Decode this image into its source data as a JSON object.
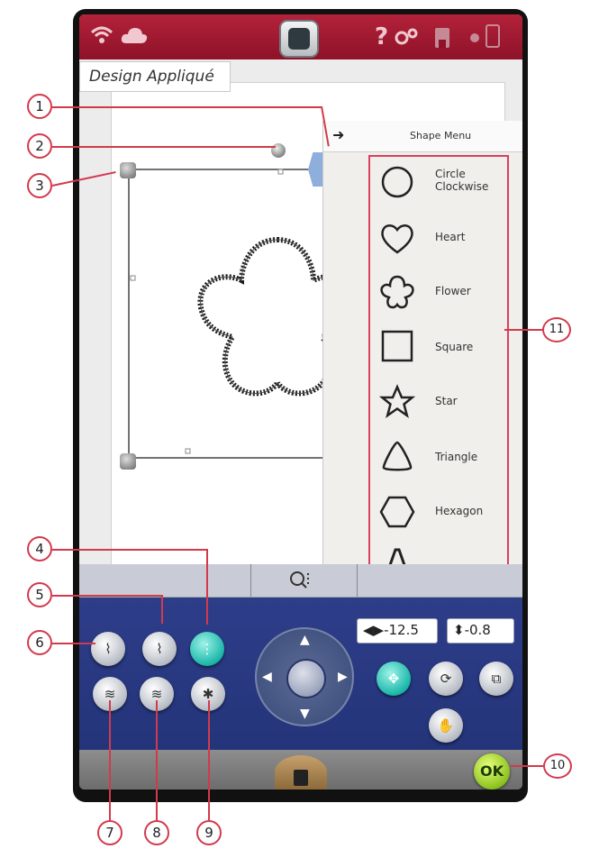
{
  "title": "Design Appliqué",
  "shape_menu": {
    "header": "Shape Menu",
    "items": [
      {
        "label": "Circle\nClockwise",
        "icon": "circle-icon"
      },
      {
        "label": "Heart",
        "icon": "heart-icon"
      },
      {
        "label": "Flower",
        "icon": "flower-icon"
      },
      {
        "label": "Square",
        "icon": "square-icon"
      },
      {
        "label": "Star",
        "icon": "star-icon"
      },
      {
        "label": "Triangle",
        "icon": "triangle-icon"
      },
      {
        "label": "Hexagon",
        "icon": "hexagon-icon"
      },
      {
        "label": "",
        "icon": "letter-a-icon"
      }
    ]
  },
  "fields": {
    "x_value": "-12.5",
    "y_value": "-0.8"
  },
  "ok_label": "OK",
  "help_label": "?",
  "colors": {
    "topbar": "#b3223a",
    "panel": "#2f3f8c",
    "accent": "#19b7a8",
    "callout": "#d23a4c",
    "ok": "#8dc21f"
  },
  "callouts": [
    "1",
    "2",
    "3",
    "4",
    "5",
    "6",
    "7",
    "8",
    "9",
    "10",
    "11"
  ]
}
